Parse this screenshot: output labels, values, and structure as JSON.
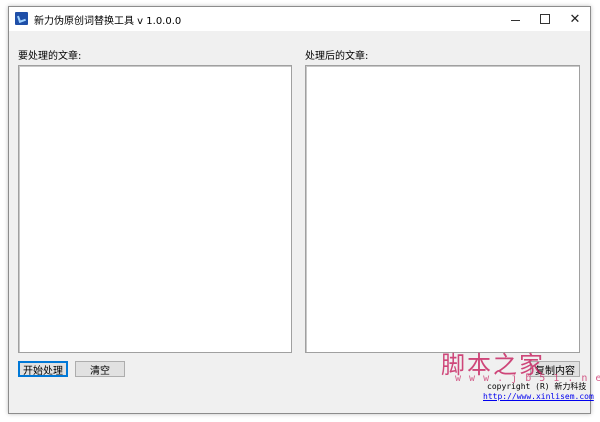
{
  "window": {
    "title": "新力伪原创词替换工具 v 1.0.0.0",
    "icon": "app-icon",
    "controls": {
      "minimize": "minimize-icon",
      "maximize": "maximize-icon",
      "close": "close-icon"
    }
  },
  "left_panel": {
    "label": "要处理的文章:",
    "value": ""
  },
  "right_panel": {
    "label": "处理后的文章:",
    "value": ""
  },
  "buttons": {
    "start": "开始处理",
    "clear": "清空",
    "copy": "复制内容"
  },
  "footer": {
    "copyright": "copyright (R) 新力科技",
    "link": "http://www.xinlisem.com"
  },
  "watermark": {
    "text": "脚本之家",
    "url": "w w w . j b 5 1 . n e t"
  },
  "colors": {
    "window_bg": "#f0f0f0",
    "focus_border": "#0078d7",
    "link": "#0000ee",
    "watermark": "#c82864"
  }
}
